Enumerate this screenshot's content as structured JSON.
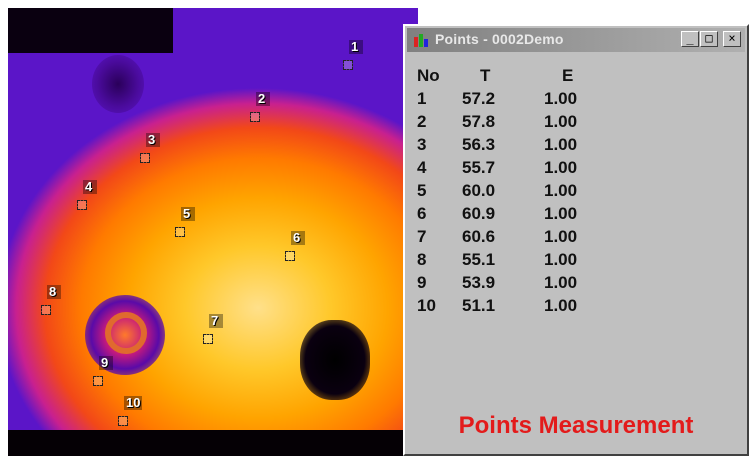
{
  "window": {
    "title": "Points - 0002Demo",
    "minimize_glyph": "_",
    "maximize_glyph": "□",
    "close_glyph": "×",
    "icon": "app-icon"
  },
  "table": {
    "headers": [
      "No",
      "T",
      "E"
    ],
    "rows": [
      [
        "1",
        "57.2",
        "1.00"
      ],
      [
        "2",
        "57.8",
        "1.00"
      ],
      [
        "3",
        "56.3",
        "1.00"
      ],
      [
        "4",
        "55.7",
        "1.00"
      ],
      [
        "5",
        "60.0",
        "1.00"
      ],
      [
        "6",
        "60.9",
        "1.00"
      ],
      [
        "7",
        "60.6",
        "1.00"
      ],
      [
        "8",
        "55.1",
        "1.00"
      ],
      [
        "9",
        "53.9",
        "1.00"
      ],
      [
        "10",
        "51.1",
        "1.00"
      ]
    ]
  },
  "footer_label": "Points Measurement",
  "markers": [
    "1",
    "2",
    "3",
    "4",
    "5",
    "6",
    "7",
    "8",
    "9",
    "10"
  ],
  "colors": {
    "footer_text": "#e31b1b",
    "window_bg": "#c0c0c0",
    "thermal_hot": "#ffe08a",
    "thermal_cold": "#5b15c8"
  }
}
